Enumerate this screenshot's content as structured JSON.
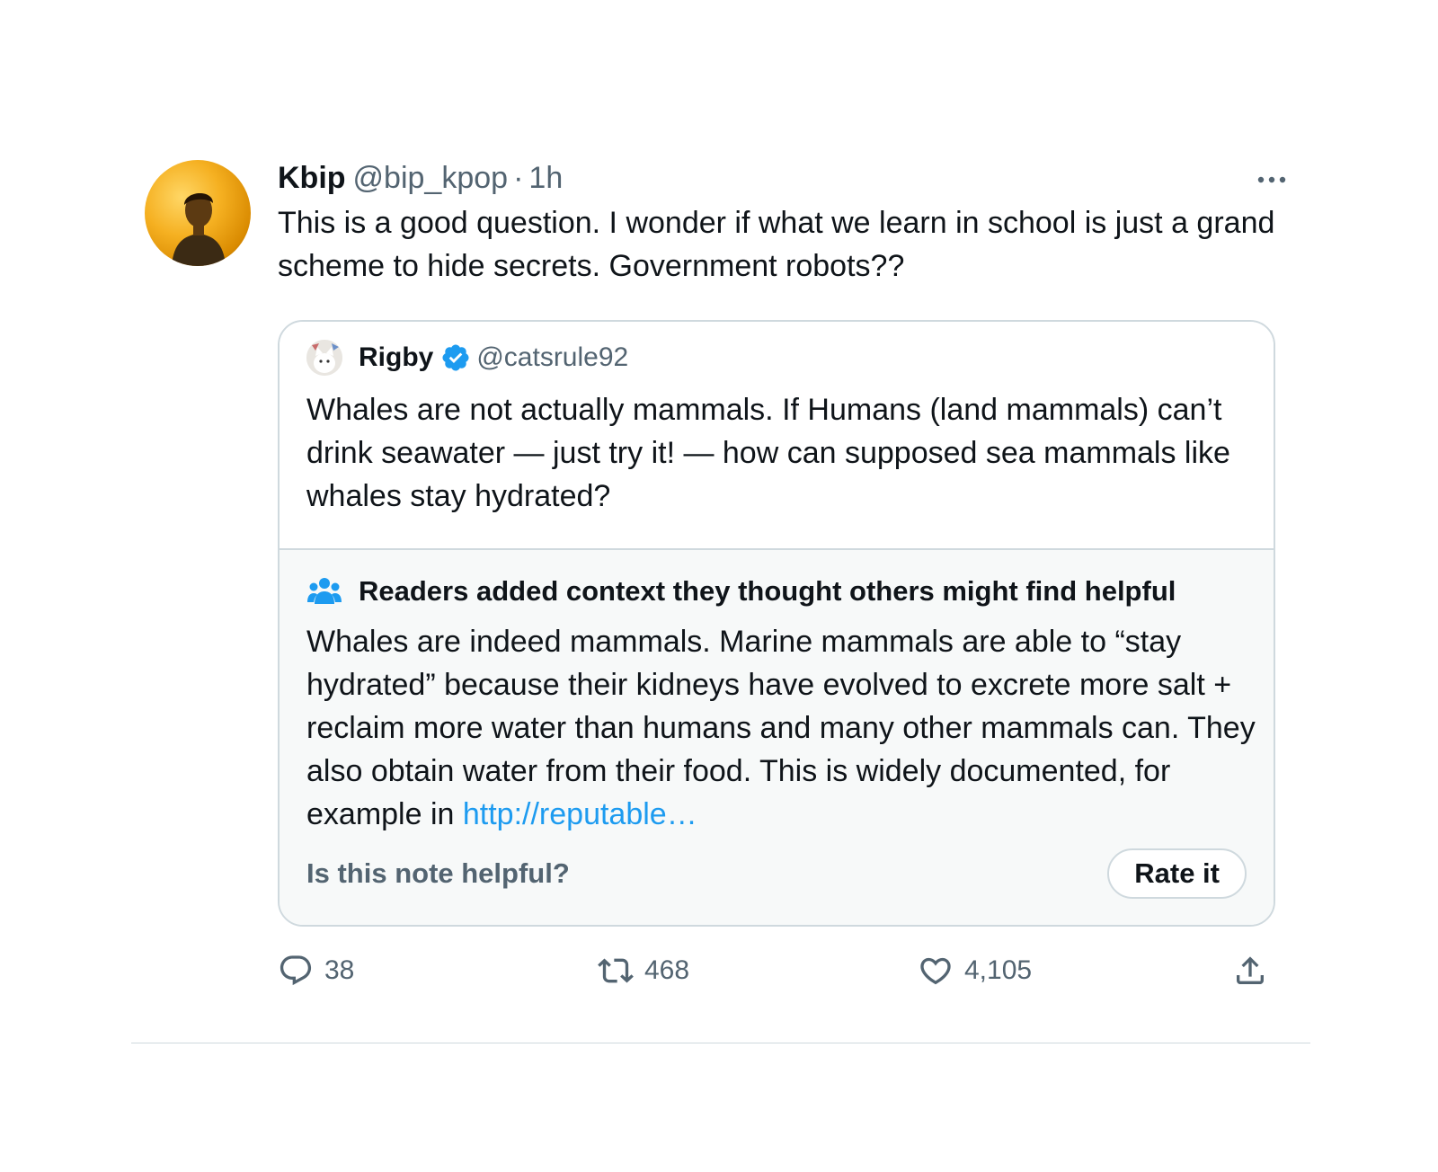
{
  "tweet": {
    "author_name": "Kbip",
    "author_handle": "@bip_kpop",
    "separator": "·",
    "time": "1h",
    "text": "This is a good question. I wonder if what we learn in school is just a grand scheme to hide secrets. Government robots??",
    "avatar_icon": "profile-photo",
    "more_icon": "more-dots-icon"
  },
  "quote": {
    "author_name": "Rigby",
    "author_handle": "@catsrule92",
    "verified": true,
    "text": "Whales are not actually mammals. If Humans (land mammals) can’t drink seawater — just try it! — how can supposed sea mammals like whales stay hydrated?"
  },
  "note": {
    "header": "Readers added context they thought others might find helpful",
    "text": "Whales are indeed mammals. Marine mammals are able to “stay hydrated” because their kidneys have evolved to excrete more salt + reclaim more water than humans and many other mammals can. They also obtain water from their food. This is widely documented, for example in ",
    "link": "http://reputable…",
    "question": "Is this note helpful?",
    "rate_label": "Rate it"
  },
  "actions": {
    "replies": "38",
    "retweets": "468",
    "likes": "4,105"
  },
  "colors": {
    "accent": "#1d9bf0",
    "muted": "#536471",
    "border": "#cfd9de",
    "note_bg": "#f7f9f9"
  }
}
